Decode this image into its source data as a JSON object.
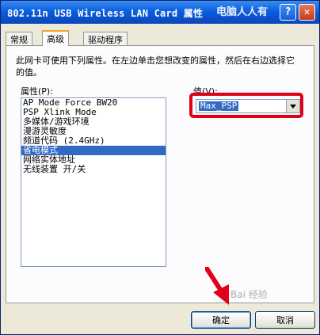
{
  "window": {
    "title": "802.11n USB Wireless LAN Card 属性",
    "watermark": "电脑人人有",
    "help_label": "?",
    "close_label": "✕"
  },
  "tabs": [
    {
      "label": "常规"
    },
    {
      "label": "高级"
    },
    {
      "label": "驱动程序"
    }
  ],
  "description": "此网卡可使用下列属性。在左边单击您想改变的属性，然后在右边选择它的值。",
  "properties": {
    "label": "属性(P):",
    "items": [
      "AP Mode Force BW20",
      "PSP Xlink Mode",
      "多媒体/游戏环境",
      "漫游灵敏度",
      "频道代码 (2.4GHz)",
      "省电模式",
      "网络实体地址",
      "无线装置 开/关"
    ],
    "selected_index": 5
  },
  "value": {
    "label": "值(V):",
    "selected": "Max_PSP",
    "dropdown_icon": "chevron-down-icon"
  },
  "buttons": {
    "ok": "确定",
    "cancel": "取消"
  },
  "annotation_watermark": "Bai 经验",
  "colors": {
    "highlight_box": "#e0001a",
    "selection": "#316ac5",
    "titlebar": "#0a5fe0"
  }
}
